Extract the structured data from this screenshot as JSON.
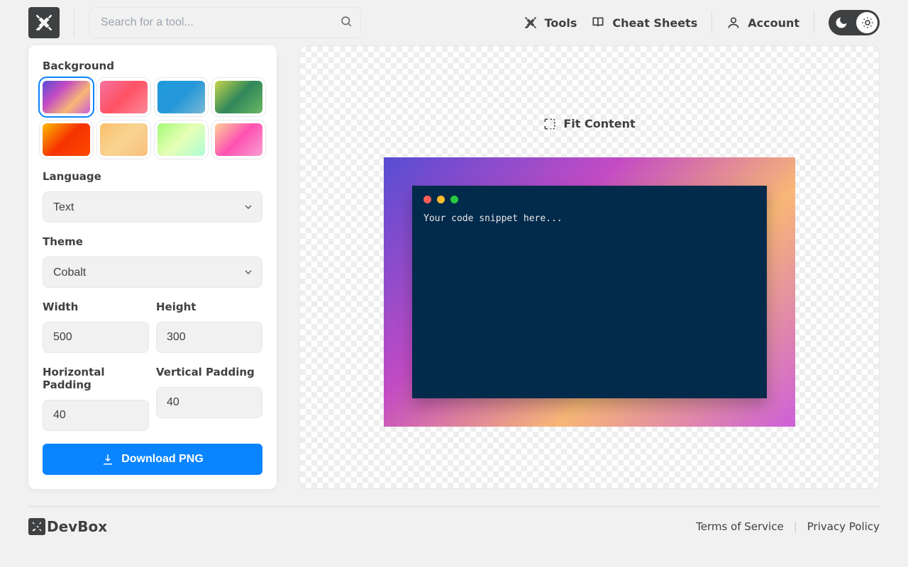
{
  "header": {
    "search_placeholder": "Search for a tool...",
    "nav": {
      "tools": "Tools",
      "cheat_sheets": "Cheat Sheets",
      "account": "Account"
    }
  },
  "panel": {
    "labels": {
      "background": "Background",
      "language": "Language",
      "theme": "Theme",
      "width": "Width",
      "height": "Height",
      "hpad": "Horizontal Padding",
      "vpad": "Vertical Padding"
    },
    "selects": {
      "language": "Text",
      "theme": "Cobalt"
    },
    "inputs": {
      "width": "500",
      "height": "300",
      "hpad": "40",
      "vpad": "40"
    },
    "download_label": "Download PNG",
    "selected_bg_index": 0
  },
  "canvas": {
    "fit_label": "Fit Content",
    "code_placeholder": "Your code snippet here...",
    "theme_bg": "#022a4a"
  },
  "footer": {
    "brand": "DevBox",
    "links": {
      "tos": "Terms of Service",
      "privacy": "Privacy Policy"
    }
  }
}
